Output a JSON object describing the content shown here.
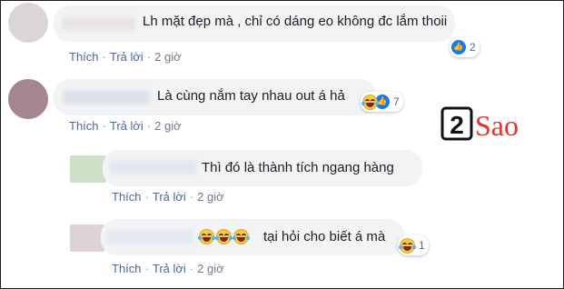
{
  "comments": [
    {
      "text": "Lh mặt đẹp mà , chỉ có dáng eo không đc lắm thoii",
      "actions": {
        "like": "Thích",
        "reply": "Trả lời",
        "time": "2 giờ"
      },
      "reaction_count": "2",
      "reactions": [
        "like-icon"
      ]
    },
    {
      "text": "Là cùng nắm tay nhau out á hả",
      "actions": {
        "like": "Thích",
        "reply": "Trả lời",
        "time": "2 giờ"
      },
      "reaction_count": "7",
      "reactions": [
        "haha-icon",
        "like-icon"
      ]
    },
    {
      "text": "Thì đó là thành tích ngang hàng",
      "actions": {
        "like": "Thích",
        "reply": "Trả lời",
        "time": "2 giờ"
      }
    },
    {
      "text": "tại hỏi cho biết á mà",
      "emoji_prefix": [
        "haha-icon",
        "haha-icon",
        "haha-icon"
      ],
      "actions": {
        "like": "Thích",
        "reply": "Trả lời",
        "time": "2 giờ"
      },
      "reaction_count": "1",
      "reactions": [
        "haha-icon"
      ]
    }
  ],
  "watermark": {
    "number": "2",
    "word": "Sao"
  },
  "colors": {
    "link": "#4b67a1",
    "bubble": "#f2f3f5",
    "brand_red": "#e5322d"
  }
}
